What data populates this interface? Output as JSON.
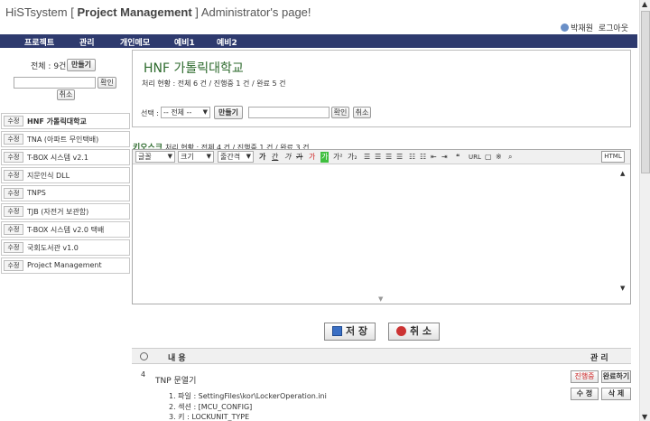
{
  "header": {
    "app_name": "HiSTsystem",
    "bracket_open": "[",
    "section": "Project Management",
    "bracket_close": "]",
    "subtitle": "Administrator's page!",
    "user_name": "박재원",
    "logout_label": "로그아웃"
  },
  "nav": {
    "items": [
      {
        "label": "프로젝트"
      },
      {
        "label": "관리"
      },
      {
        "label": "개인메모"
      },
      {
        "label": "예비1"
      },
      {
        "label": "예비2"
      }
    ]
  },
  "sidebar": {
    "total_label": "전체 : 9건",
    "make_button": "만들기",
    "confirm_button": "확인",
    "cancel_button": "취소",
    "projects": [
      {
        "edit": "수정",
        "name": "HNF 가톨릭대학교",
        "active": true
      },
      {
        "edit": "수정",
        "name": "TNA (아파트 무인택배)"
      },
      {
        "edit": "수정",
        "name": "T-BOX 시스템 v2.1"
      },
      {
        "edit": "수정",
        "name": "지문인식 DLL"
      },
      {
        "edit": "수정",
        "name": "TNPS"
      },
      {
        "edit": "수정",
        "name": "TJB (자전거 보관함)"
      },
      {
        "edit": "수정",
        "name": "T-BOX 시스템 v2.0 택배"
      },
      {
        "edit": "수정",
        "name": "국회도서관 v1.0"
      },
      {
        "edit": "수정",
        "name": "Project Management"
      }
    ]
  },
  "main": {
    "project_title": "HNF 가톨릭대학교",
    "status_line": "처리 현황 : 전체 6 건 / 진행중 1 건 / 완료 5 건",
    "select_label": "선택 :",
    "select_value": "-- 전체 --",
    "make_button": "만들기",
    "confirm_button": "확인",
    "cancel_button": "취소"
  },
  "kiosk": {
    "name": "키오스크",
    "status": "처리 현황 : 전체 4 건 / 진행중 1 건 / 완료 3 건"
  },
  "editor": {
    "font_label": "글꼴",
    "size_label": "크기",
    "line_label": "줄간격",
    "format_buttons": [
      "가",
      "간",
      "가",
      "가",
      "가",
      "가",
      "가²",
      "가₂"
    ],
    "link_label": "URL",
    "html_label": "HTML"
  },
  "actions": {
    "save_label": "저 장",
    "cancel_label": "취 소"
  },
  "list": {
    "col_content": "내 용",
    "col_manage": "관 리",
    "rows": [
      {
        "num": "4",
        "title": "TNP 문열기",
        "details": [
          "1. 파일 : SettingFiles\\kor\\LockerOperation.ini",
          "2. 섹션 : [MCU_CONFIG]",
          "3. 키 : LOCKUNIT_TYPE"
        ],
        "status_btn": "진행중",
        "complete_btn": "완료하기",
        "edit_btn": "수 정",
        "delete_btn": "삭 제"
      }
    ]
  },
  "colors": {
    "nav_bg": "#2e3a6e",
    "title_green": "#2d6a2d",
    "status_red": "#cc2222"
  }
}
